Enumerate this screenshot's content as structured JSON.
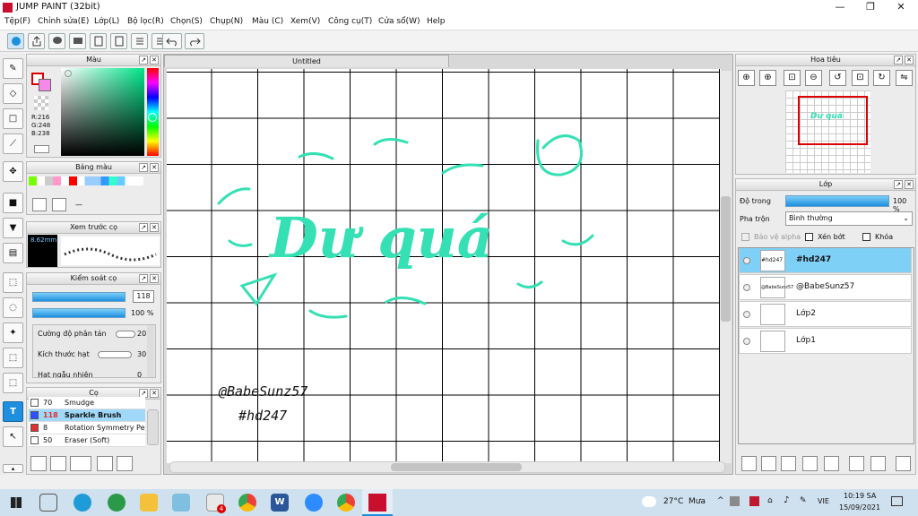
{
  "window": {
    "title": "JUMP PAINT (32bit)"
  },
  "menu": [
    "Tệp(F)",
    "Chỉnh sửa(E)",
    "Lớp(L)",
    "Bộ lọc(R)",
    "Chọn(S)",
    "Chụp(N)",
    "Màu (C)",
    "Xem(V)",
    "Công cụ(T)",
    "Cửa sổ(W)",
    "Help"
  ],
  "panels": {
    "color": "Màu",
    "palette": "Bảng màu",
    "preview": "Xem trước cọ",
    "brush_control": "Kiểm soát cọ",
    "brush": "Cọ",
    "navigator": "Hoa tiêu",
    "layer": "Lớp",
    "tab": "Untitled"
  },
  "color": {
    "r": "R:216",
    "g": "G:248",
    "b": "B:238",
    "accent": "#1e8fde",
    "fg": "#d8f8ee"
  },
  "preview": {
    "size": "8.62mm"
  },
  "brush_control": {
    "size": "118",
    "opacity": "100 %",
    "params": [
      {
        "label": "Cường độ phân tán",
        "value": "20"
      },
      {
        "label": "Kích thước hạt",
        "value": "30"
      },
      {
        "label": "Hạt ngẫu nhiên",
        "value": "0"
      }
    ]
  },
  "brushes": [
    {
      "num": "70",
      "name": "Smudge",
      "color": "#ffffff"
    },
    {
      "num": "118",
      "name": "Sparkle Brush",
      "color": "#3050ff"
    },
    {
      "num": "8",
      "name": "Rotation Symmetry Pe",
      "color": "#e03030"
    },
    {
      "num": "50",
      "name": "Eraser (Soft)",
      "color": "#ffffff"
    }
  ],
  "layer": {
    "opacity_label": "Độ trong",
    "opacity_value": "100 %",
    "blend_label": "Pha trộn",
    "blend_value": "Bình thường",
    "protect_alpha": "Bảo vệ alpha",
    "clip": "Xén bớt",
    "lock": "Khóa",
    "layers": [
      {
        "name": "#hd247"
      },
      {
        "name": "@BabeSunz57"
      },
      {
        "name": "Lớp2"
      },
      {
        "name": "Lớp1"
      }
    ]
  },
  "canvas": {
    "title_text": "Dư quá",
    "sign1": "@BabeSunz57",
    "sign2": "#hd247",
    "ink": "#34e0b4"
  },
  "taskbar": {
    "weather": "27°C",
    "condition": "Mưa",
    "lang": "VIE",
    "time": "10:19 SA",
    "date": "15/09/2021",
    "badge": "4"
  }
}
